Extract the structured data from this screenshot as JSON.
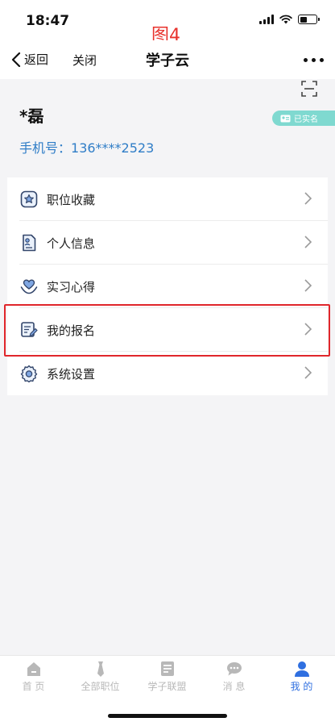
{
  "status": {
    "time": "18:47"
  },
  "annotation": "图4",
  "nav": {
    "back_label": "返回",
    "close_label": "关闭",
    "title": "学子云"
  },
  "profile": {
    "name": "*磊",
    "verify_badge": "已实名",
    "phone_label": "手机号：",
    "phone_value": "136****2523"
  },
  "menu": {
    "items": [
      {
        "label": "职位收藏",
        "icon": "star-badge-icon"
      },
      {
        "label": "个人信息",
        "icon": "profile-card-icon"
      },
      {
        "label": "实习心得",
        "icon": "heart-hand-icon"
      },
      {
        "label": "我的报名",
        "icon": "edit-document-icon"
      },
      {
        "label": "系统设置",
        "icon": "settings-gear-icon"
      }
    ]
  },
  "tabbar": {
    "tabs": [
      {
        "label": "首 页",
        "icon": "home-icon"
      },
      {
        "label": "全部职位",
        "icon": "tie-icon"
      },
      {
        "label": "学子联盟",
        "icon": "news-icon"
      },
      {
        "label": "消 息",
        "icon": "chat-icon"
      },
      {
        "label": "我 的",
        "icon": "user-icon"
      }
    ],
    "active_index": 4,
    "active_color": "#2f6fe0",
    "inactive_color": "#b8b8b8"
  },
  "colors": {
    "phone": "#2f7dc7",
    "badge": "#7fd9d0",
    "highlight": "#e0262b",
    "annotation": "#e8322c"
  }
}
